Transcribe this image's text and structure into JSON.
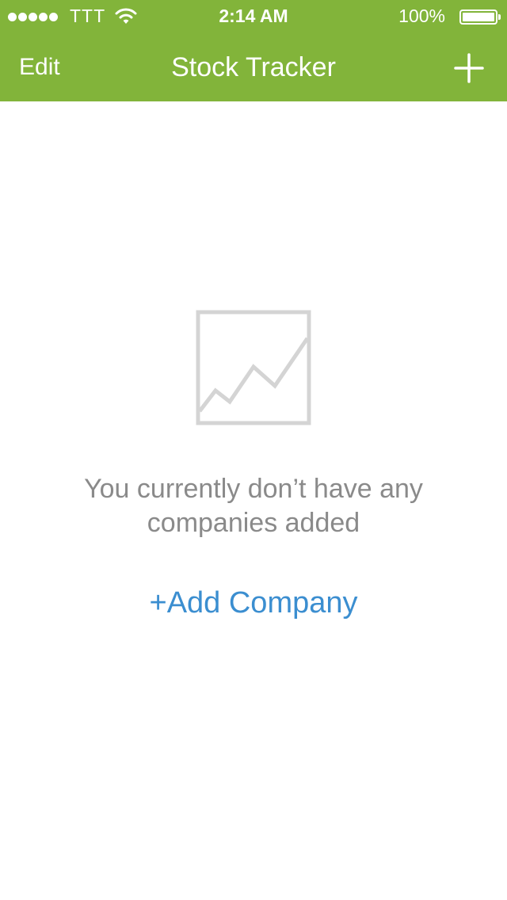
{
  "status_bar": {
    "carrier": "TTT",
    "time": "2:14 AM",
    "battery_percent": "100%",
    "signal_bars": 5,
    "battery_level": 1.0
  },
  "nav": {
    "edit_label": "Edit",
    "title": "Stock Tracker",
    "add_icon": "plus-icon"
  },
  "empty_state": {
    "icon": "line-chart-icon",
    "message": "You currently don’t have any companies added",
    "add_company_label": "+Add Company"
  },
  "colors": {
    "header_bg": "#82b43a",
    "link": "#3b8ed0",
    "muted_text": "#8a8a8a",
    "illustration": "#d4d4d4"
  }
}
